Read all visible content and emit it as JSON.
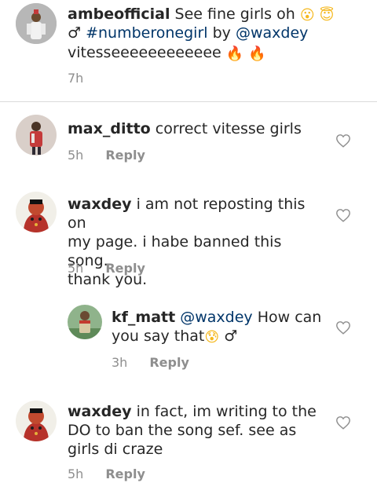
{
  "comments": [
    {
      "username": "ambeofficial",
      "text_before": "See fine girls oh",
      "emoji_1": "😮",
      "emoji_2": "😇",
      "gender_glyph": "♂",
      "box_glyph": "",
      "hashtag": "#numberonegirl",
      "by_text": "by",
      "mention": "@waxdey",
      "line3": "vitesseeeeeeeeeeee",
      "fire": "🔥",
      "time": "7h"
    },
    {
      "username": "max_ditto",
      "text": "correct vitesse girls",
      "time": "5h",
      "reply_label": "Reply"
    },
    {
      "username": "waxdey",
      "text_line1": "i am not reposting this on",
      "text_line2": "my page. i habe banned this song.",
      "text_line3": "thank you.",
      "time": "5h",
      "reply_label": "Reply"
    },
    {
      "username": "kf_matt",
      "mention": "@waxdey",
      "text_after_mention": "How can",
      "text_line2": "you say that",
      "emoji": "😰",
      "box_glyph": "",
      "gender_glyph": "♂",
      "time": "3h",
      "reply_label": "Reply"
    },
    {
      "username": "waxdey",
      "text_line1": "in fact, im writing to the",
      "text_line2": "DO to ban the song sef. see as",
      "text_line3": "girls di craze",
      "box_glyph": "",
      "time": "5h",
      "reply_label": "Reply"
    }
  ]
}
